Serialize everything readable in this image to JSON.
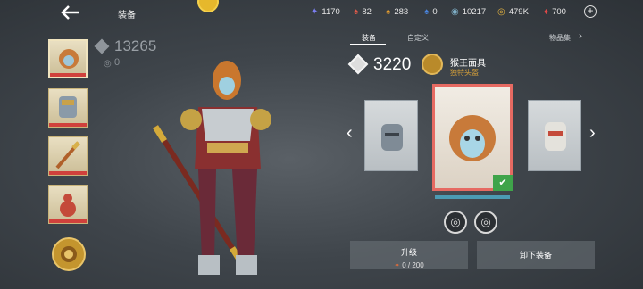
{
  "header": {
    "title": "装备"
  },
  "resources": [
    {
      "icon": "blue-star-icon",
      "color": "#7b7ef0",
      "value": "1170"
    },
    {
      "icon": "red-flame-icon",
      "color": "#e05a4a",
      "value": "82"
    },
    {
      "icon": "orange-flame-icon",
      "color": "#e8a030",
      "value": "283"
    },
    {
      "icon": "blue-flame-icon",
      "color": "#4a86e0",
      "value": "0"
    },
    {
      "icon": "swirl-coin-icon",
      "color": "#7fb0c8",
      "value": "10217"
    },
    {
      "icon": "gold-coin-icon",
      "color": "#e0b040",
      "value": "479K"
    },
    {
      "icon": "red-gem-icon",
      "color": "#e04848",
      "value": "700"
    }
  ],
  "left_panel": {
    "score": "13265",
    "sub_score": "0"
  },
  "tabs": [
    {
      "label": "装备",
      "active": true
    },
    {
      "label": "自定义",
      "active": false
    },
    {
      "label": "物品集",
      "active": false
    }
  ],
  "item": {
    "power": "3220",
    "name": "猴王面具",
    "rarity": "独特头盔"
  },
  "buttons": {
    "upgrade_label": "升级",
    "upgrade_cost": "0 / 200",
    "unequip_label": "卸下装备"
  }
}
